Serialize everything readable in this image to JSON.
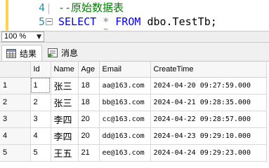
{
  "editor": {
    "lines": [
      {
        "number": "4",
        "comment": "--原始数据表"
      },
      {
        "number": "5",
        "keyword_select": "SELECT",
        "star": "*",
        "keyword_from": "FROM",
        "table": "dbo.TestTb;"
      }
    ]
  },
  "zoom": {
    "value": "100 %"
  },
  "tabs": {
    "results": "结果",
    "messages": "消息"
  },
  "grid": {
    "columns": [
      "Id",
      "Name",
      "Age",
      "Email",
      "CreateTime"
    ],
    "rows": [
      {
        "row_number": "1",
        "cells": [
          "1",
          "张三",
          "18",
          "aa@163.com",
          "2024-04-20 09:27:59.000"
        ]
      },
      {
        "row_number": "2",
        "cells": [
          "2",
          "张三",
          "18",
          "bb@163.com",
          "2024-04-21 09:28:35.000"
        ]
      },
      {
        "row_number": "3",
        "cells": [
          "3",
          "李四",
          "20",
          "cc@163.com",
          "2024-04-22 09:28:57.000"
        ]
      },
      {
        "row_number": "4",
        "cells": [
          "4",
          "李四",
          "20",
          "dd@163.com",
          "2024-04-23 09:29:10.000"
        ]
      },
      {
        "row_number": "5",
        "cells": [
          "5",
          "王五",
          "21",
          "ee@163.com",
          "2024-04-24 09:29:23.000"
        ]
      }
    ]
  },
  "colors": {
    "keyword": "#0000ff",
    "comment": "#008000",
    "line_number": "#2b91af",
    "margin_marker": "#ffd34d"
  }
}
